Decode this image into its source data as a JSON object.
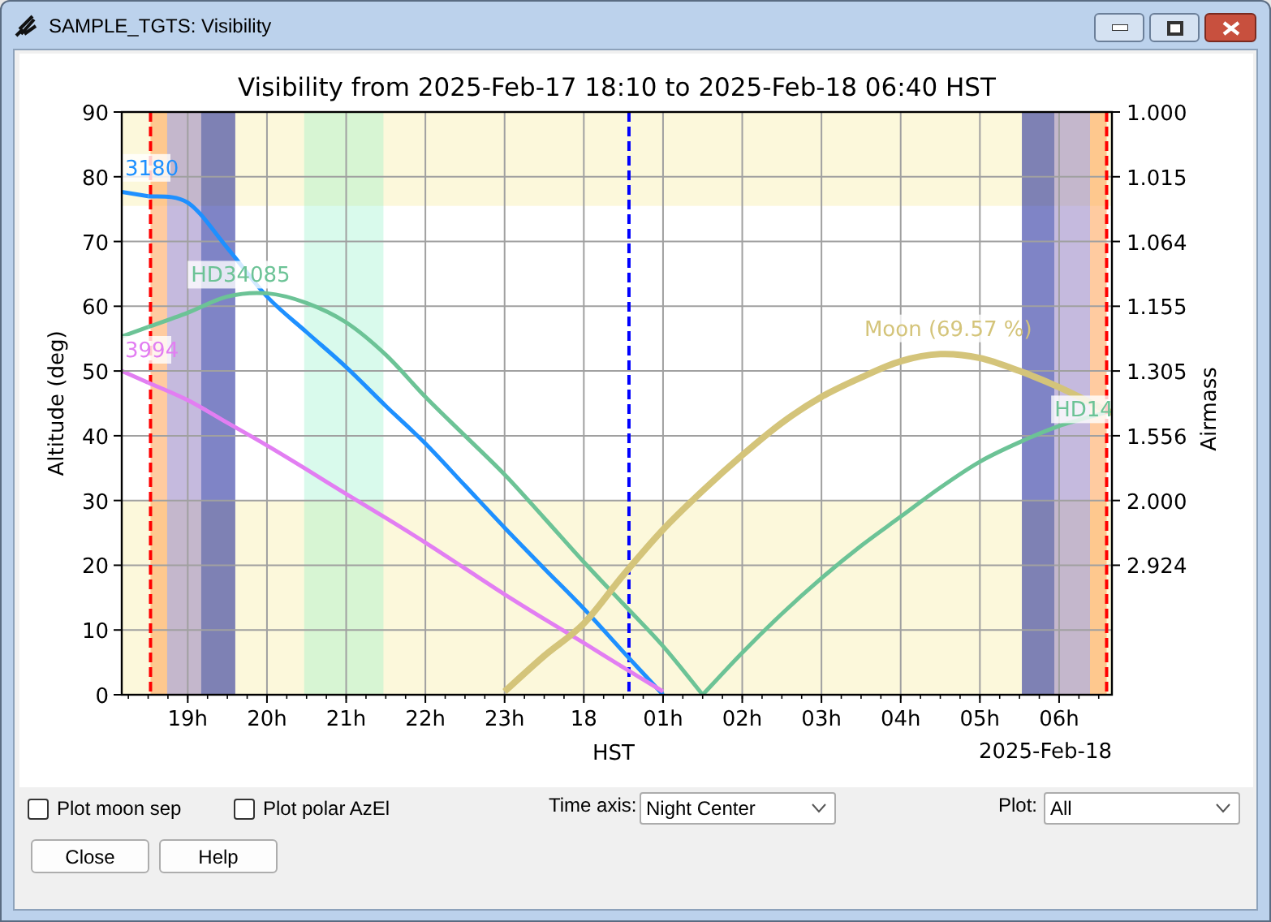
{
  "window": {
    "title": "SAMPLE_TGTS: Visibility"
  },
  "plot": {
    "chart_data": {
      "type": "line",
      "title": "Visibility from 2025-Feb-17 18:10 to 2025-Feb-18 06:40 HST",
      "xlabel": "HST",
      "ylabel": "Altitude (deg)",
      "categories": [
        null,
        null,
        "19h",
        null,
        "20h",
        null,
        "21h",
        null,
        "22h",
        null,
        "23h",
        null,
        "18",
        null,
        "01h",
        null,
        "02h",
        null,
        "03h",
        null,
        "04h",
        null,
        "05h",
        null,
        "06h",
        null,
        null
      ],
      "ylim": [
        0,
        90
      ],
      "grid": true,
      "yticks": [
        0,
        10,
        20,
        30,
        40,
        50,
        60,
        70,
        80,
        90
      ],
      "series": [
        {
          "name": "3180",
          "color": "#1e90ff",
          "values": [
            null,
            77,
            76,
            69,
            61.5,
            56,
            50.6,
            44.6,
            38.8,
            32.3,
            25.8,
            19.5,
            13.3,
            6.6,
            0,
            null,
            null,
            null,
            null,
            null,
            null,
            null,
            null,
            null,
            null,
            null,
            null
          ]
        },
        {
          "name": "HD34085",
          "color": "#6cc396",
          "values": [
            null,
            56.8,
            59,
            61.5,
            62,
            60.5,
            57.5,
            52.5,
            46,
            40,
            34,
            27.3,
            20.5,
            14,
            7.5,
            0,
            null,
            null,
            null,
            null,
            null,
            null,
            null,
            null,
            null,
            null,
            null
          ]
        },
        {
          "name": "3994",
          "color": "#e27ef2",
          "values": [
            null,
            48.2,
            45.5,
            42,
            38.5,
            34.8,
            31,
            27.3,
            23.5,
            19.5,
            15.5,
            11.7,
            8,
            4.2,
            0.5,
            null,
            null,
            null,
            null,
            null,
            null,
            null,
            null,
            null,
            null,
            null,
            null
          ]
        },
        {
          "name": "HD14",
          "color": "#6cc396",
          "values": [
            null,
            null,
            null,
            null,
            null,
            null,
            null,
            null,
            null,
            null,
            null,
            null,
            null,
            null,
            null,
            0,
            6.5,
            12.5,
            18,
            23,
            27.5,
            32,
            36,
            39,
            41.5,
            43.3,
            null
          ]
        },
        {
          "name": "Moon (69.57 %)",
          "color": "#d4c47a",
          "values": [
            null,
            null,
            null,
            null,
            null,
            null,
            null,
            null,
            null,
            null,
            0.5,
            6,
            11,
            18.5,
            25.5,
            31.5,
            37,
            42,
            46,
            49,
            51.5,
            52.6,
            52,
            50,
            47.5,
            44.5,
            null
          ]
        }
      ]
    },
    "date_label": "2025-Feb-18",
    "airmass_axis": {
      "title": "Airmass",
      "labels": [
        "1.000",
        "1.015",
        "1.064",
        "1.155",
        "1.305",
        "1.556",
        "2.000",
        "2.924"
      ]
    }
  },
  "controls": {
    "checkboxes": [
      {
        "label": "Plot moon sep",
        "checked": false
      },
      {
        "label": "Plot polar AzEl",
        "checked": false
      }
    ],
    "time_axis": {
      "label": "Time axis:",
      "value": "Night Center"
    },
    "plot_select": {
      "label": "Plot:",
      "value": "All"
    }
  },
  "buttons": [
    "Close",
    "Help"
  ]
}
